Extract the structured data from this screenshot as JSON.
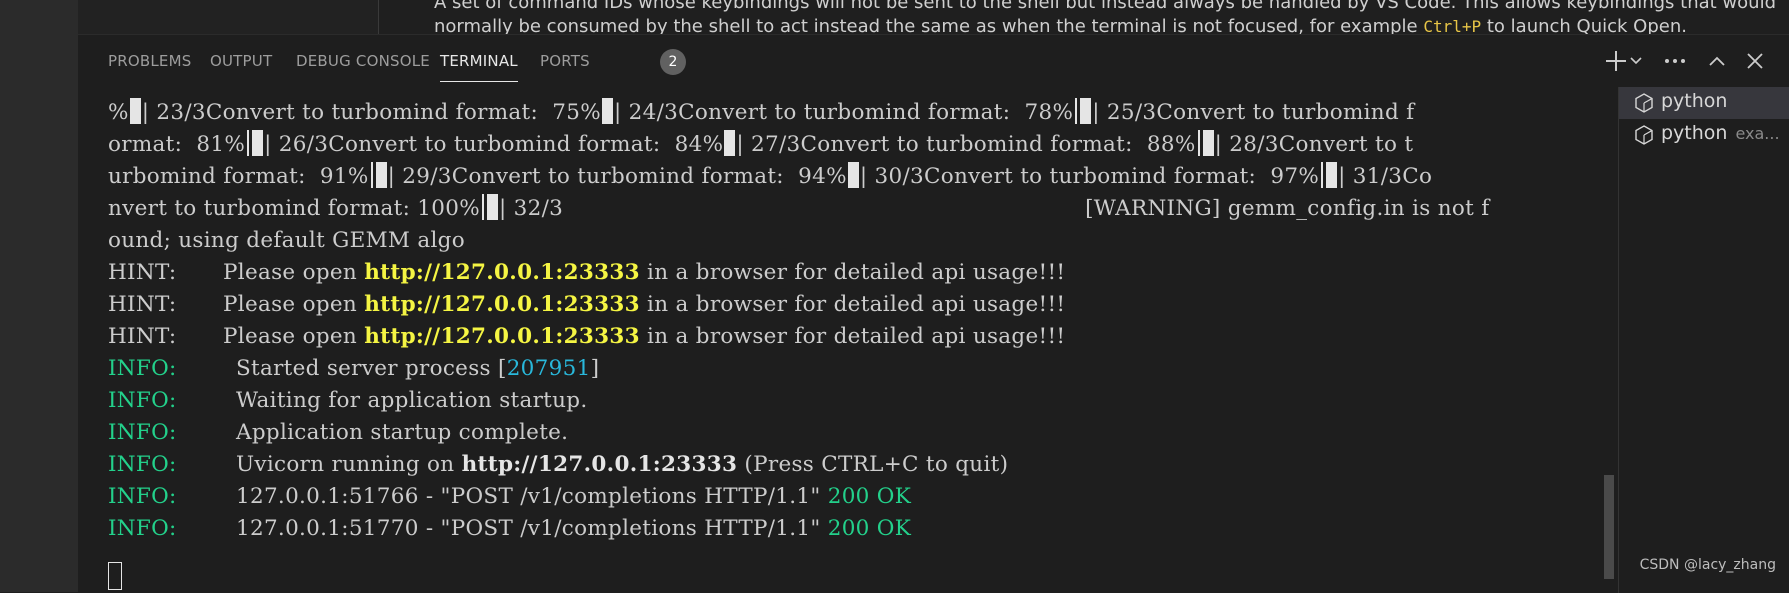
{
  "editor_peek": {
    "line1": "A set of command IDs whose keybindings will not be sent to the shell but instead always be handled by VS Code. This allows keybindings that would",
    "line2_before": "normally be consumed by the shell to act instead the same as when the terminal is not focused, for example ",
    "line2_kbd": "Ctrl+P",
    "line2_after": " to launch Quick Open."
  },
  "panel": {
    "tabs": [
      {
        "label": "PROBLEMS"
      },
      {
        "label": "OUTPUT"
      },
      {
        "label": "DEBUG CONSOLE"
      },
      {
        "label": "TERMINAL"
      },
      {
        "label": "PORTS"
      }
    ],
    "ports_badge": "2",
    "active_tab": "TERMINAL",
    "actions": {
      "new_terminal": "new-terminal-icon",
      "more": "more-icon",
      "maximize": "chevron-up-icon",
      "close": "close-icon"
    }
  },
  "terminal": {
    "line1": {
      "a": "%",
      "b": "| 23/3Convert to turbomind format:  75%",
      "c": "| 24/3Convert to turbomind format:  78%",
      "d": "| 25/3Convert to turbomind f"
    },
    "line2": {
      "a": "ormat:  81%",
      "b": "| 26/3Convert to turbomind format:  84%",
      "c": "| 27/3Convert to turbomind format:  88%",
      "d": "| 28/3Convert to t"
    },
    "line3": {
      "a": "urbomind format:  91%",
      "b": "| 29/3Convert to turbomind format:  94%",
      "c": "| 30/3Convert to turbomind format:  97%",
      "d": "| 31/3Co"
    },
    "line4": {
      "a": "nvert to turbomind format: 100%",
      "b": "| 32/3",
      "c": "[WARNING] gemm_config.in is not f"
    },
    "line5": "ound; using default GEMM algo",
    "hint": {
      "label": "HINT:",
      "before": "Please open ",
      "url": "http://127.0.0.1:23333",
      "after": " in a browser for detailed api usage!!!"
    },
    "info_label": "INFO:",
    "info1_before": "Started server process [",
    "info1_pid": "207951",
    "info1_after": "]",
    "info2": "Waiting for application startup.",
    "info3": "Application startup complete.",
    "info4_before": "Uvicorn running on ",
    "info4_url": "http://127.0.0.1:23333",
    "info4_after": " (Press CTRL+C to quit)",
    "info5_text": "127.0.0.1:51766 - \"POST /v1/completions HTTP/1.1\" ",
    "info6_text": "127.0.0.1:51770 - \"POST /v1/completions HTTP/1.1\" ",
    "status_ok": "200 OK"
  },
  "terminal_list": {
    "items": [
      {
        "name": "python",
        "sub": ""
      },
      {
        "name": "python",
        "sub": "exa..."
      }
    ]
  },
  "watermark": "CSDN @lacy_zhang"
}
